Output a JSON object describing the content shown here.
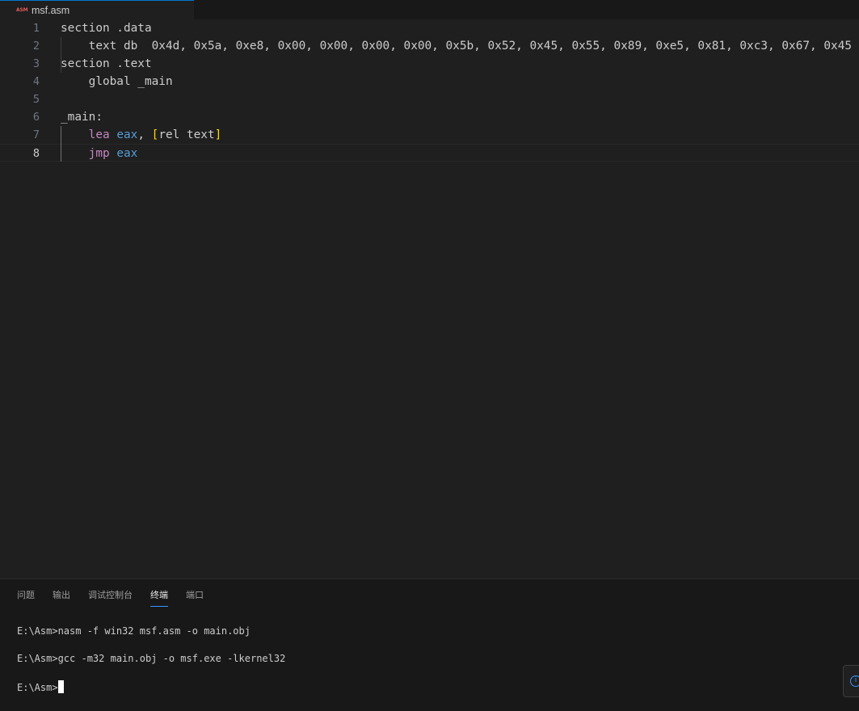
{
  "tab": {
    "icon": "asm-file-icon",
    "icon_text": "ASM",
    "title": "msf.asm"
  },
  "editor": {
    "lines": [
      {
        "no": "1",
        "tokens": [
          {
            "t": "section .data",
            "c": ""
          }
        ]
      },
      {
        "no": "2",
        "tokens": [
          {
            "t": "    text db  0x4d, 0x5a, 0xe8, 0x00, 0x00, 0x00, 0x00, 0x5b, 0x52, 0x45, 0x55, 0x89, 0xe5, 0x81, 0xc3, 0x67, 0x45",
            "c": ""
          }
        ]
      },
      {
        "no": "3",
        "tokens": [
          {
            "t": "section .text",
            "c": ""
          }
        ]
      },
      {
        "no": "4",
        "tokens": [
          {
            "t": "    global _main",
            "c": ""
          }
        ]
      },
      {
        "no": "5",
        "tokens": []
      },
      {
        "no": "6",
        "tokens": [
          {
            "t": "_main:",
            "c": ""
          }
        ]
      },
      {
        "no": "7",
        "tokens": [
          {
            "t": "    ",
            "c": ""
          },
          {
            "t": "lea",
            "c": "kw"
          },
          {
            "t": " ",
            "c": ""
          },
          {
            "t": "eax",
            "c": "reg"
          },
          {
            "t": ", ",
            "c": ""
          },
          {
            "t": "[",
            "c": "br"
          },
          {
            "t": "rel text",
            "c": ""
          },
          {
            "t": "]",
            "c": "br"
          }
        ]
      },
      {
        "no": "8",
        "tokens": [
          {
            "t": "    ",
            "c": ""
          },
          {
            "t": "jmp",
            "c": "kw"
          },
          {
            "t": " ",
            "c": ""
          },
          {
            "t": "eax",
            "c": "reg"
          }
        ]
      }
    ],
    "active_line": "8"
  },
  "panel": {
    "tabs": [
      "问题",
      "输出",
      "调试控制台",
      "终端",
      "端口"
    ],
    "active_tab": "终端",
    "terminal": [
      "E:\\Asm>nasm -f win32 msf.asm -o main.obj",
      "E:\\Asm>gcc -m32 main.obj -o msf.exe -lkernel32",
      "E:\\Asm>"
    ]
  },
  "notification": {
    "icon": "info-icon"
  }
}
